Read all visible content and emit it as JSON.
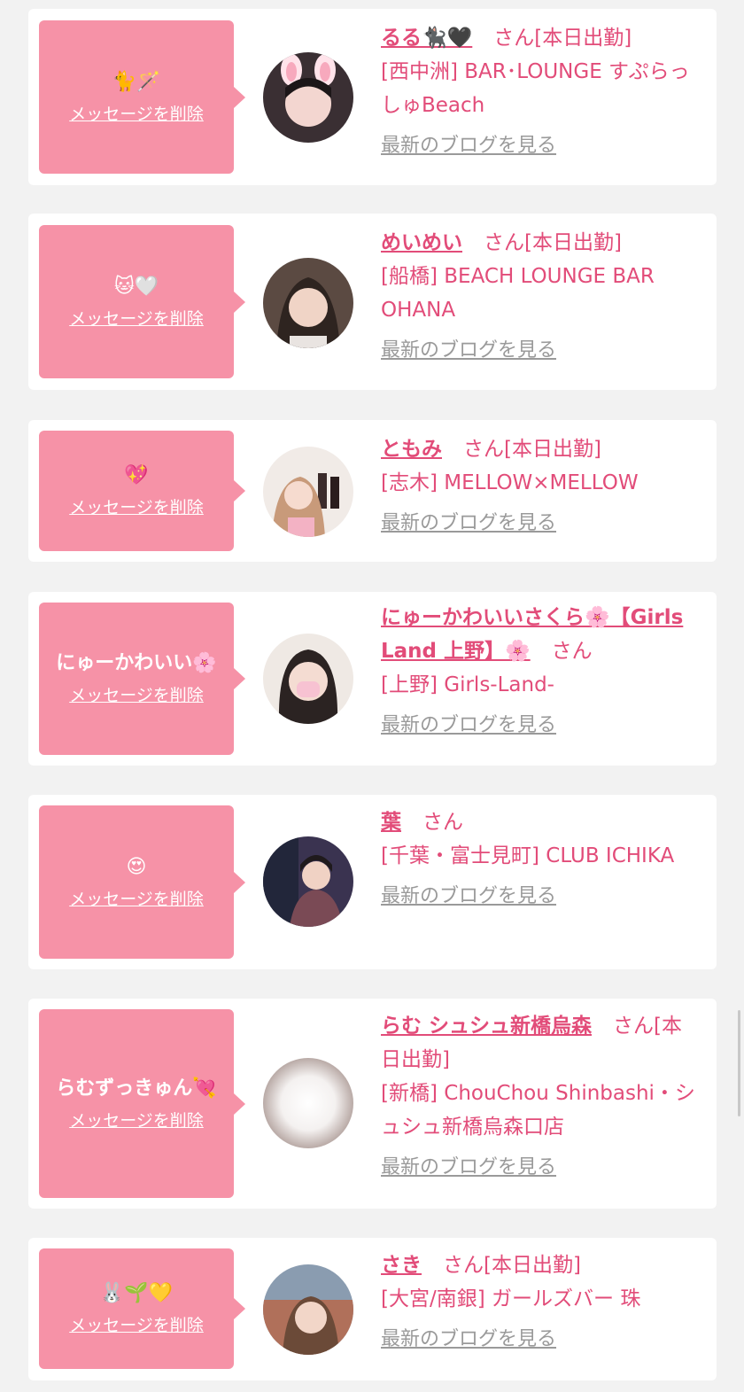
{
  "delete_label": "メッセージを削除",
  "blog_label": "最新のブログを見る",
  "honorific": "さん",
  "cards": [
    {
      "message": "🐈🪄",
      "name": "るる🐈‍⬛🖤",
      "status": "[本日出勤]",
      "shop": "[西中洲] BAR･LOUNGE すぷらっしゅBeach"
    },
    {
      "message": "🐱🤍",
      "name": "めいめい",
      "status": "[本日出勤]",
      "shop": "[船橋] BEACH LOUNGE BAR OHANA"
    },
    {
      "message": "💖",
      "name": "ともみ",
      "status": "[本日出勤]",
      "shop": "[志木] MELLOW×MELLOW"
    },
    {
      "message": "にゅーかわいい🌸",
      "name": "にゅーかわいいさくら🌸【Girls Land 上野】🌸",
      "status": "",
      "shop": "[上野] Girls-Land-"
    },
    {
      "message": "😍",
      "name": "葉",
      "status": "",
      "shop": "[千葉・富士見町] CLUB ICHIKA"
    },
    {
      "message": "らむずっきゅん💘",
      "name": "らむ シュシュ新橋烏森",
      "status": "[本日出勤]",
      "shop": "[新橋] ChouChou Shinbashi・シュシュ新橋烏森口店"
    },
    {
      "message": "🐰🌱💛",
      "name": "さき",
      "status": "[本日出勤]",
      "shop": "[大宮/南銀] ガールズバー 珠"
    }
  ],
  "colors": {
    "accent": "#e24c79",
    "bubble": "#f692a7",
    "link_gray": "#9a9a9a",
    "background": "#f2f2f2"
  }
}
